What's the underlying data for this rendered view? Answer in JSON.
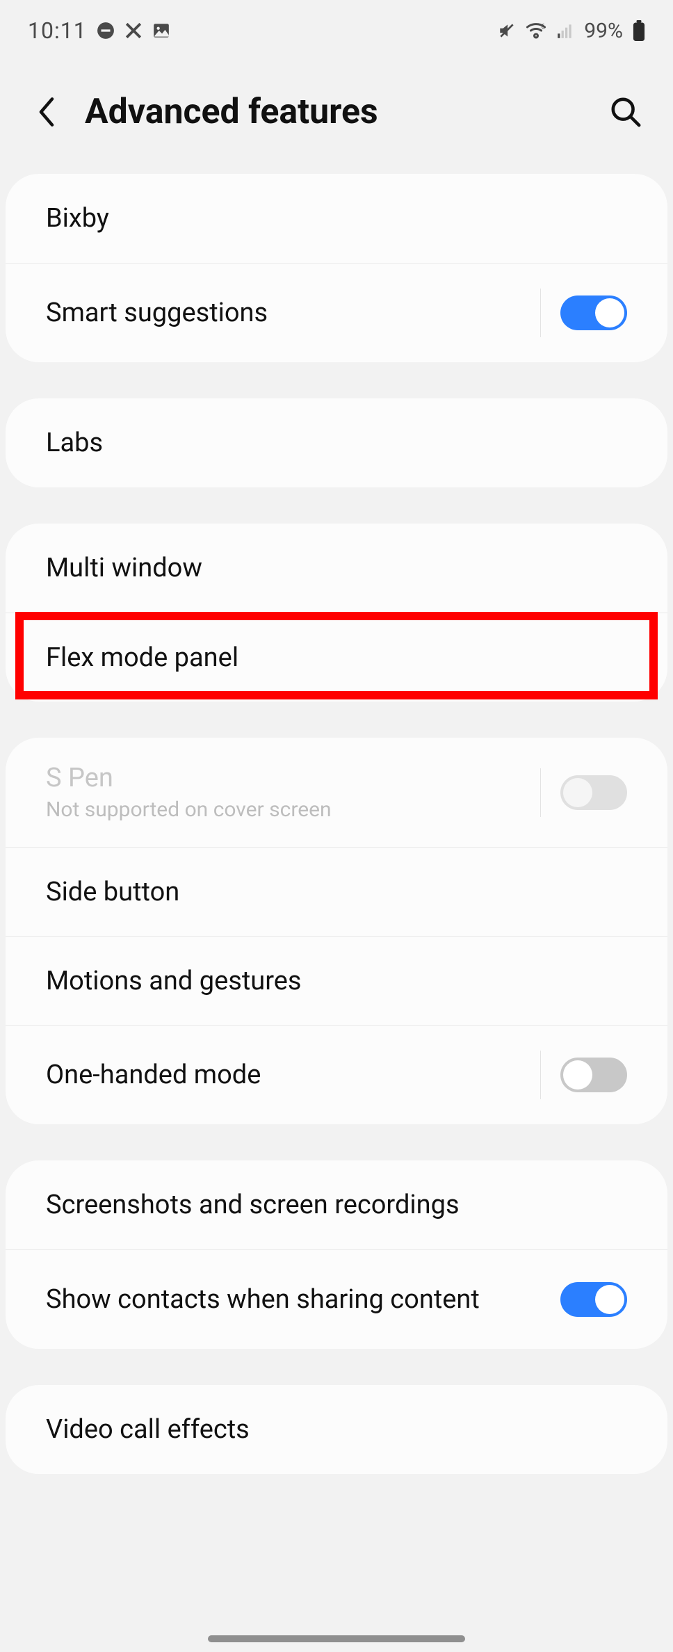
{
  "status": {
    "time": "10:11",
    "battery_pct": "99%"
  },
  "header": {
    "title": "Advanced features"
  },
  "groups": [
    {
      "items": [
        {
          "id": "bixby",
          "title": "Bixby",
          "interactable": true
        },
        {
          "id": "smart-suggestions",
          "title": "Smart suggestions",
          "toggle": "on",
          "divider": true,
          "interactable": true
        }
      ]
    },
    {
      "items": [
        {
          "id": "labs",
          "title": "Labs",
          "interactable": true
        }
      ]
    },
    {
      "items": [
        {
          "id": "multi-window",
          "title": "Multi window",
          "interactable": true,
          "highlight": true
        },
        {
          "id": "flex-mode-panel",
          "title": "Flex mode panel",
          "interactable": true
        }
      ]
    },
    {
      "items": [
        {
          "id": "s-pen",
          "title": "S Pen",
          "subtitle": "Not supported on cover screen",
          "toggle": "off",
          "divider": true,
          "disabled": true,
          "interactable": false
        },
        {
          "id": "side-button",
          "title": "Side button",
          "interactable": true
        },
        {
          "id": "motions-gestures",
          "title": "Motions and gestures",
          "interactable": true
        },
        {
          "id": "one-handed-mode",
          "title": "One-handed mode",
          "toggle": "off",
          "divider": true,
          "interactable": true
        }
      ]
    },
    {
      "items": [
        {
          "id": "screenshots-recordings",
          "title": "Screenshots and screen recordings",
          "interactable": true
        },
        {
          "id": "show-contacts-sharing",
          "title": "Show contacts when sharing content",
          "toggle": "on",
          "divider": false,
          "interactable": true
        }
      ]
    },
    {
      "items": [
        {
          "id": "video-call-effects",
          "title": "Video call effects",
          "interactable": true
        }
      ]
    }
  ]
}
